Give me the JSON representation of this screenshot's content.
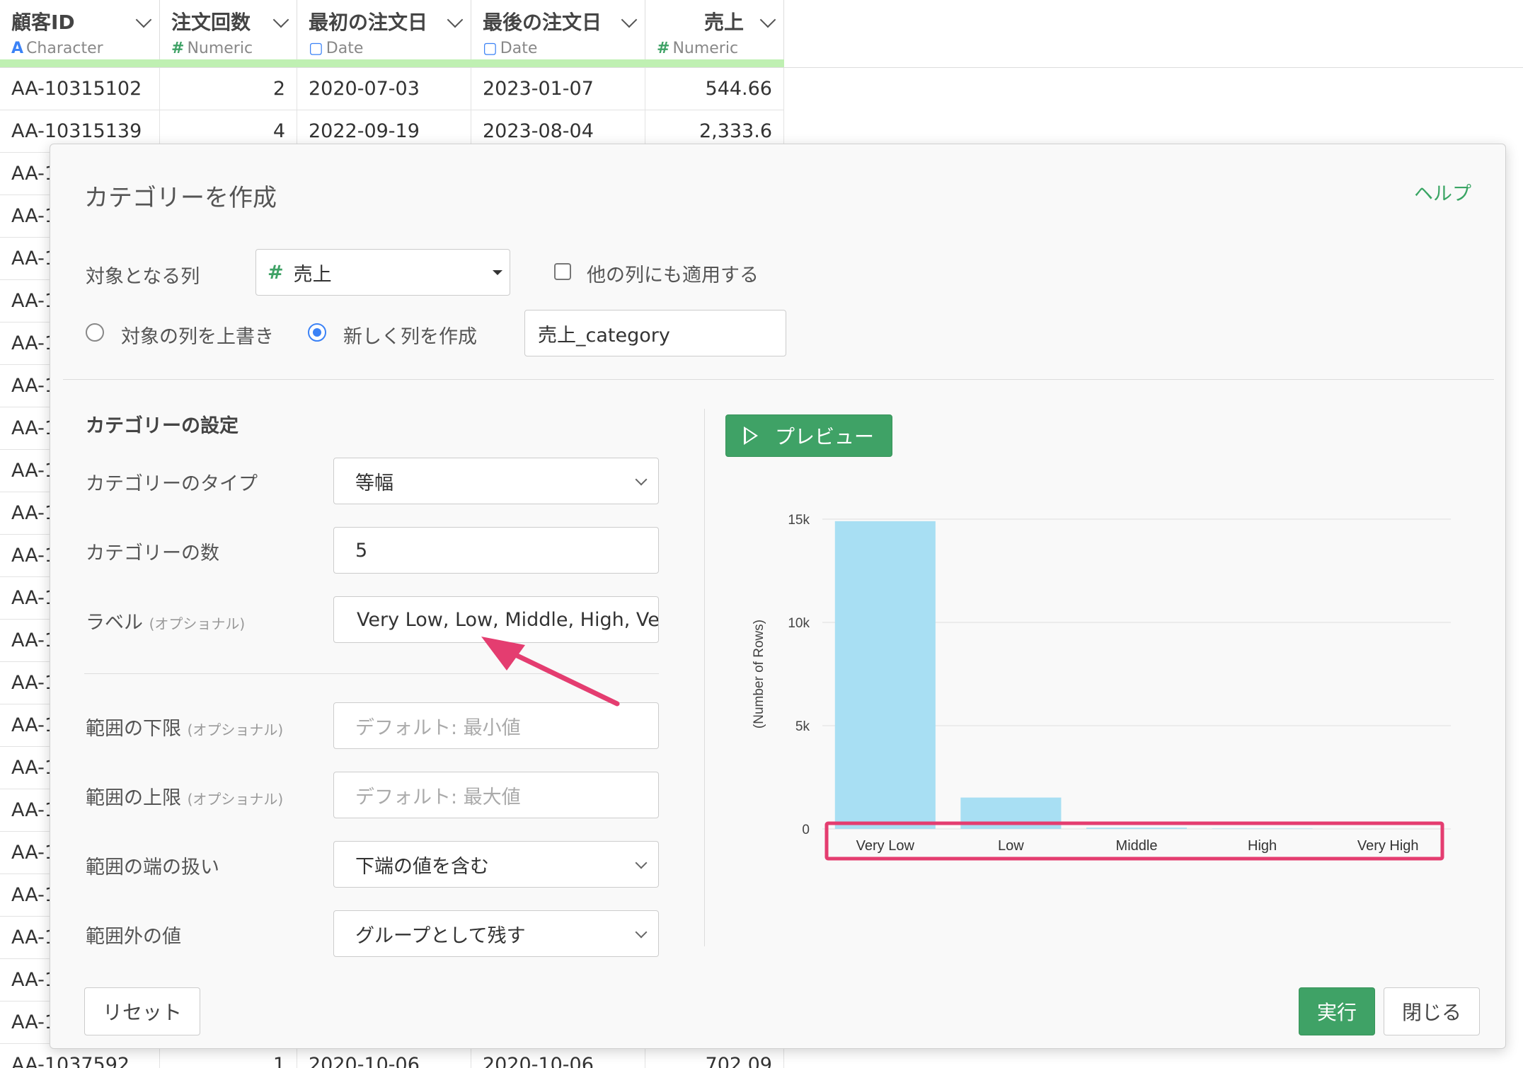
{
  "grid": {
    "columns": [
      {
        "name": "顧客ID",
        "type": "Character",
        "type_icon": "A",
        "icon_name": "character-type-icon",
        "align": "left"
      },
      {
        "name": "注文回数",
        "type": "Numeric",
        "type_icon": "#",
        "icon_name": "numeric-type-icon",
        "align": "left"
      },
      {
        "name": "最初の注文日",
        "type": "Date",
        "type_icon": "▢",
        "icon_name": "calendar-icon",
        "align": "left"
      },
      {
        "name": "最後の注文日",
        "type": "Date",
        "type_icon": "▢",
        "icon_name": "calendar-icon",
        "align": "left"
      },
      {
        "name": "売上",
        "type": "Numeric",
        "type_icon": "#",
        "icon_name": "numeric-type-icon",
        "align": "right"
      }
    ],
    "rows": [
      [
        "AA-10315102",
        "2",
        "2020-07-03",
        "2023-01-07",
        "544.66"
      ],
      [
        "AA-10315139",
        "4",
        "2022-09-19",
        "2023-08-04",
        "2,333.6"
      ],
      [
        "AA-1",
        "",
        "",
        "",
        ""
      ],
      [
        "AA-1",
        "",
        "",
        "",
        ""
      ],
      [
        "AA-1",
        "",
        "",
        "",
        ""
      ],
      [
        "AA-1",
        "",
        "",
        "",
        ""
      ],
      [
        "AA-1",
        "",
        "",
        "",
        ""
      ],
      [
        "AA-1",
        "",
        "",
        "",
        ""
      ],
      [
        "AA-1",
        "",
        "",
        "",
        ""
      ],
      [
        "AA-1",
        "",
        "",
        "",
        ""
      ],
      [
        "AA-1",
        "",
        "",
        "",
        ""
      ],
      [
        "AA-1",
        "",
        "",
        "",
        ""
      ],
      [
        "AA-1",
        "",
        "",
        "",
        ""
      ],
      [
        "AA-1",
        "",
        "",
        "",
        ""
      ],
      [
        "AA-1",
        "",
        "",
        "",
        ""
      ],
      [
        "AA-1",
        "",
        "",
        "",
        ""
      ],
      [
        "AA-1",
        "",
        "",
        "",
        ""
      ],
      [
        "AA-1",
        "",
        "",
        "",
        ""
      ],
      [
        "AA-1",
        "",
        "",
        "",
        ""
      ],
      [
        "AA-1",
        "",
        "",
        "",
        ""
      ],
      [
        "AA-1",
        "",
        "",
        "",
        ""
      ],
      [
        "AA-1",
        "",
        "",
        "",
        ""
      ],
      [
        "AA-1",
        "",
        "",
        "",
        ""
      ],
      [
        "AA-1037592",
        "1",
        "2020-10-06",
        "2020-10-06",
        "702.09"
      ]
    ],
    "colors": {
      "character": "#3b82f6",
      "numeric": "#3fa266",
      "date": "#3b82f6",
      "quality_bar": "#bff0b2"
    }
  },
  "dialog": {
    "title": "カテゴリーを作成",
    "help_link": "ヘルプ",
    "target_column_label": "対象となる列",
    "target_column_value": "売上",
    "target_column_icon": "#",
    "apply_other_columns_label": "他の列にも適用する",
    "apply_other_columns_checked": false,
    "overwrite_label": "対象の列を上書き",
    "new_column_label": "新しく列を作成",
    "selected_mode": "new_column",
    "new_column_name": "売上_category",
    "settings_title": "カテゴリーの設定",
    "category_type_label": "カテゴリーのタイプ",
    "category_type_value": "等幅",
    "category_count_label": "カテゴリーの数",
    "category_count_value": "5",
    "labels_label": "ラベル",
    "optional_text": "(オプショナル)",
    "labels_value": "Very Low, Low, Middle, High, Ve",
    "range_min_label": "範囲の下限",
    "range_min_placeholder": "デフォルト: 最小値",
    "range_max_label": "範囲の上限",
    "range_max_placeholder": "デフォルト: 最大値",
    "edge_handling_label": "範囲の端の扱い",
    "edge_handling_value": "下端の値を含む",
    "out_of_range_label": "範囲外の値",
    "out_of_range_value": "グループとして残す",
    "preview_button": "プレビュー",
    "reset_button": "リセット",
    "run_button": "実行",
    "close_button": "閉じる",
    "accent_color": "#3fa266",
    "annotation_color": "#e43d70"
  },
  "chart_data": {
    "type": "bar",
    "categories": [
      "Very Low",
      "Low",
      "Middle",
      "High",
      "Very High"
    ],
    "values": [
      14900,
      1520,
      60,
      20,
      0
    ],
    "ylabel": "(Number of Rows)",
    "ylim": [
      0,
      15000
    ],
    "yticks": [
      0,
      5000,
      10000,
      15000
    ],
    "ytick_labels": [
      "0",
      "5k",
      "10k",
      "15k"
    ],
    "grid": true,
    "bar_color": "#a8dff3"
  }
}
